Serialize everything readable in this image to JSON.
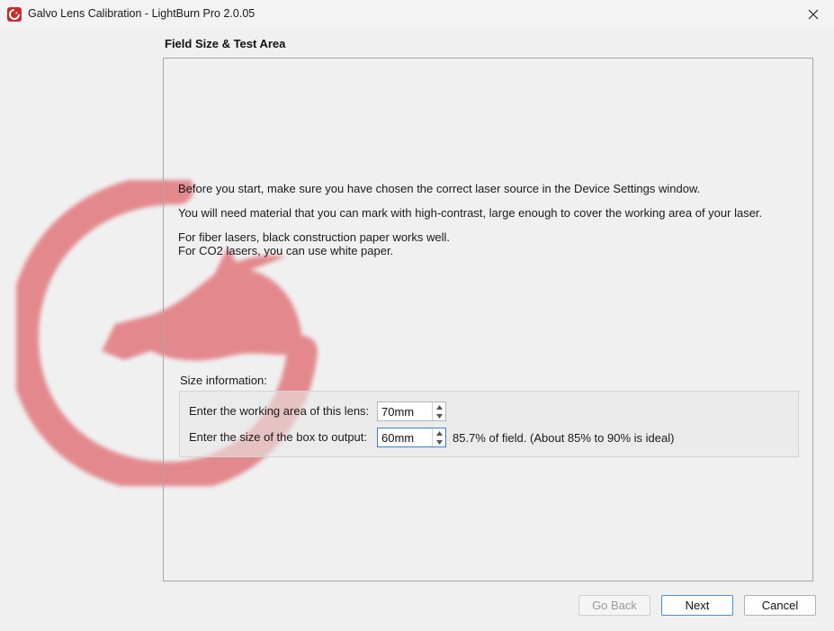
{
  "window": {
    "title": "Galvo Lens Calibration - LightBurn Pro 2.0.05",
    "app_icon": "lightburn-logo-icon",
    "close_icon": "close-icon"
  },
  "page": {
    "heading": "Field Size & Test Area",
    "paragraphs": [
      "Before you start, make sure you have chosen the correct laser source in the Device Settings window.",
      "You will need material that you can mark with high-contrast, large enough to cover the working area of your laser.",
      "For fiber lasers, black construction paper works well.",
      "For CO2 lasers, you can use white paper."
    ]
  },
  "size_info": {
    "title": "Size information:",
    "working_area_label": "Enter the working area of this lens:",
    "working_area_value": "70mm",
    "box_size_label": "Enter the size of the box to output:",
    "box_size_value": "60mm",
    "box_size_note": "85.7% of field.  (About 85% to 90% is ideal)"
  },
  "buttons": {
    "back": "Go Back",
    "next": "Next",
    "cancel": "Cancel"
  },
  "colors": {
    "watermark": "#d9363e",
    "focus": "#3b7fd6"
  }
}
